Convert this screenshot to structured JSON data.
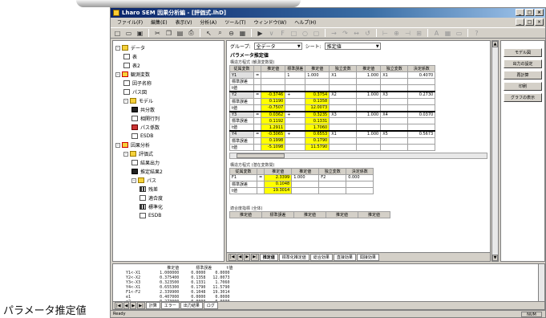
{
  "window": {
    "title": "Lharo SEM 因果分析編 - [評価式.lhD]",
    "controls": [
      "_",
      "□",
      "×"
    ]
  },
  "menubar": {
    "items": [
      "ファイル(F)",
      "編集(E)",
      "表示(V)",
      "分析(A)",
      "ツール(T)",
      "ウィンドウ(W)",
      "ヘルプ(H)"
    ]
  },
  "toolbar": {
    "icons": [
      "new-icon",
      "open-icon",
      "save-icon",
      "cut-icon",
      "copy-icon",
      "paste-icon",
      "print-icon",
      "arrow-icon",
      "zoom-icon",
      "chart-icon"
    ]
  },
  "tree": {
    "nodes": [
      {
        "label": "データ",
        "depth": 0,
        "icon": "folder",
        "exp": "-"
      },
      {
        "label": "表",
        "depth": 1,
        "icon": "doc"
      },
      {
        "label": "表2",
        "depth": 1,
        "icon": "doc"
      },
      {
        "label": "観測変数",
        "depth": 0,
        "icon": "folder",
        "exp": "-"
      },
      {
        "label": "因子名称",
        "depth": 1,
        "icon": "doc"
      },
      {
        "label": "パス図",
        "depth": 1,
        "icon": "doc"
      },
      {
        "label": "モデル",
        "depth": 1,
        "icon": "folder",
        "exp": "-"
      },
      {
        "label": "共分散",
        "depth": 2,
        "icon": "dark"
      },
      {
        "label": "相関行列",
        "depth": 2,
        "icon": "doc"
      },
      {
        "label": "パス係数",
        "depth": 2,
        "icon": "redd"
      },
      {
        "label": "ESDB",
        "depth": 2,
        "icon": "doc"
      },
      {
        "label": "因果分析",
        "depth": 0,
        "icon": "folder",
        "exp": "-"
      },
      {
        "label": "評価式",
        "depth": 1,
        "icon": "folder",
        "exp": "-"
      },
      {
        "label": "結果出力",
        "depth": 2,
        "icon": "doc"
      },
      {
        "label": "推定結果2",
        "depth": 2,
        "icon": "dark"
      },
      {
        "label": "パス",
        "depth": 2,
        "icon": "folder",
        "exp": "-"
      },
      {
        "label": "残差",
        "depth": 3,
        "icon": "bars"
      },
      {
        "label": "適合度",
        "depth": 3,
        "icon": "doc"
      },
      {
        "label": "標準化",
        "depth": 3,
        "icon": "bars"
      },
      {
        "label": "ESDB",
        "depth": 3,
        "icon": "doc"
      }
    ]
  },
  "content": {
    "group_label": "グループ:",
    "group_value": "全データ",
    "sheet_label": "シート:",
    "sheet_value": "推定値",
    "heading": "パラメータ推定値",
    "subheading": "構造方程式 (観測変数間)",
    "table1": {
      "headers": [
        "従属変数",
        "",
        "推定値",
        "標準誤差",
        "推定値",
        "独立変数",
        "推定値",
        "独立変数",
        "決定係数"
      ],
      "blocks": [
        {
          "name": "Y1",
          "rows": [
            [
              "",
              "=",
              "",
              "1",
              "1.000",
              "X1",
              "1.000",
              "X1",
              "0.4070"
            ],
            [
              "標準誤差",
              "",
              "",
              "",
              "",
              "",
              "",
              "",
              ""
            ],
            [
              "t値",
              "",
              "",
              "",
              "",
              "",
              "",
              "",
              ""
            ]
          ]
        },
        {
          "name": "Y2",
          "rows": [
            [
              "",
              "=",
              "-0.3746",
              "+",
              "0.3754",
              "X2",
              "1.000",
              "X3",
              "0.2730"
            ],
            [
              "標準誤差",
              "",
              "0.1190",
              "",
              "0.1358",
              "",
              "",
              "",
              ""
            ],
            [
              "t値",
              "",
              "-0.7507",
              "",
              "12.0073",
              "",
              "",
              "",
              ""
            ]
          ]
        },
        {
          "name": "Y3",
          "rows": [
            [
              "",
              "=",
              "0.0362",
              "+",
              "0.3235",
              "X3",
              "1.000",
              "X4",
              "0.0370"
            ],
            [
              "標準誤差",
              "",
              "0.1192",
              "",
              "0.1331",
              "",
              "",
              "",
              ""
            ],
            [
              "t値",
              "",
              "1.2911",
              "",
              "1.7060",
              "",
              "",
              "",
              ""
            ]
          ]
        },
        {
          "name": "Y4",
          "rows": [
            [
              "",
              "=",
              "-0.3065",
              "+",
              "0.6553",
              "X1",
              "1.000",
              "X5",
              "0.5673"
            ],
            [
              "標準誤差",
              "",
              "0.1998",
              "",
              "0.1790",
              "",
              "",
              "",
              ""
            ],
            [
              "t値",
              "",
              "-5.1098",
              "",
              "11.5790",
              "",
              "",
              "",
              ""
            ]
          ]
        }
      ]
    },
    "subheading2": "構造方程式 (潜在変数間)",
    "table2": {
      "headers": [
        "従属変数",
        "",
        "推定値",
        "推定値",
        "独立変数",
        "決定係数"
      ],
      "rows": [
        [
          "F1",
          "=",
          "2.3399",
          "1.000",
          "F2",
          "0.000"
        ],
        [
          "標準誤差",
          "",
          "0.1048",
          "",
          "",
          ""
        ],
        [
          "t値",
          "",
          "19.3014",
          "",
          "",
          ""
        ]
      ]
    },
    "footer_label": "適合度指標 (全体)",
    "footer_cols": [
      "推定値",
      "標準誤差",
      "推定値",
      "推定値",
      "推定値"
    ],
    "sheet_tabs": [
      "推定値",
      "標準化推定値",
      "総合効果",
      "直接効果",
      "間接効果"
    ]
  },
  "right_panel": {
    "buttons": [
      "モデル図",
      "出力の設定",
      "再計算",
      "印刷",
      "グラフの表示"
    ]
  },
  "output": {
    "lines": [
      "                   推定値       標準誤差      t値",
      "  Y1<-X1        1.000000     0.0000    0.0000",
      "  Y2<-X2        0.375400     0.1358   12.0073",
      "  Y3<-X3        0.323500     0.1331    1.7060",
      "  Y4<-X1        0.655300     0.1790   11.5790",
      "  F1<-F2        2.339900     0.1048   19.3014",
      "  e1            0.407000     0.0000    0.0000",
      "  e2            0.273000     0.0000    0.0000"
    ],
    "tabs": [
      "計算",
      "エラー",
      "出力結果",
      "ログ"
    ]
  },
  "statusbar": {
    "text": "Ready",
    "right": "NUM"
  },
  "caption": "パラメータ推定値"
}
